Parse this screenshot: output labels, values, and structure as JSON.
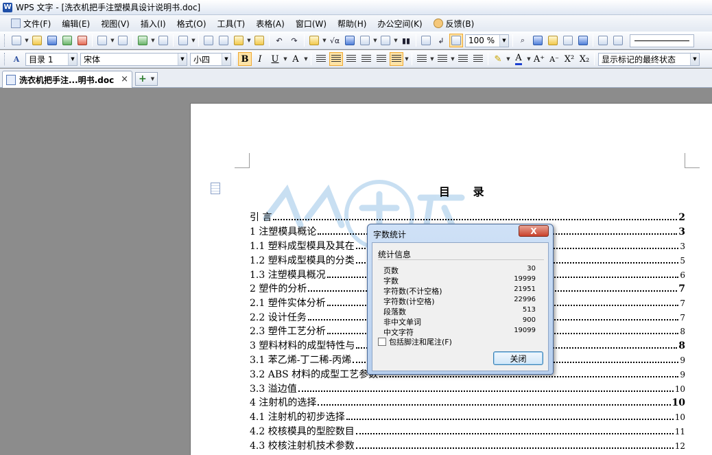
{
  "window": {
    "title": "WPS 文字 - [洗衣机把手注塑模具设计说明书.doc]"
  },
  "menu": [
    {
      "label": "文件(F)"
    },
    {
      "label": "编辑(E)"
    },
    {
      "label": "视图(V)"
    },
    {
      "label": "插入(I)"
    },
    {
      "label": "格式(O)"
    },
    {
      "label": "工具(T)"
    },
    {
      "label": "表格(A)"
    },
    {
      "label": "窗口(W)"
    },
    {
      "label": "帮助(H)"
    },
    {
      "label": "办公空间(K)"
    },
    {
      "label": "反馈(B)"
    }
  ],
  "toolbar1": {
    "zoom": "100 %"
  },
  "toolbar2": {
    "style": "目录 1",
    "font": "宋体",
    "size": "小四",
    "bold": "B",
    "italic": "I",
    "underline": "U",
    "sup": "X²",
    "sub": "X₂",
    "track": "显示标记的最终状态"
  },
  "tab": {
    "label": "洗衣机把手注...明书.doc",
    "close": "×",
    "new": "+"
  },
  "document": {
    "title": "目 录",
    "toc": [
      {
        "text": "引  言",
        "page": "2",
        "major": true
      },
      {
        "text": "1   注塑模具概论",
        "page": "3",
        "major": true
      },
      {
        "text": "1.1 塑料成型模具及其在",
        "page": "3",
        "major": false
      },
      {
        "text": "1.2 塑料成型模具的分类",
        "page": "5",
        "major": false
      },
      {
        "text": "1.3 注塑模具概况",
        "page": "6",
        "major": false
      },
      {
        "text": "2 塑件的分析",
        "page": "7",
        "major": true
      },
      {
        "text": "2.1 塑件实体分析",
        "page": "7",
        "major": false
      },
      {
        "text": "2.2 设计任务",
        "page": "7",
        "major": false
      },
      {
        "text": "2.3 塑件工艺分析",
        "page": "8",
        "major": false
      },
      {
        "text": "3 塑料材料的成型特性与",
        "page": "8",
        "major": true
      },
      {
        "text": "3.1 苯乙烯-丁二稀-丙烯",
        "page": "9",
        "major": false
      },
      {
        "text": "3.2 ABS 材料的成型工艺参数",
        "page": "9",
        "major": false
      },
      {
        "text": "3.3   溢边值",
        "page": "10",
        "major": false
      },
      {
        "text": "4 注射机的选择",
        "page": "10",
        "major": true
      },
      {
        "text": "4.1 注射机的初步选择",
        "page": "10",
        "major": false
      },
      {
        "text": "4.2 校核模具的型腔数目",
        "page": "11",
        "major": false
      },
      {
        "text": "4.3 校核注射机技术参数",
        "page": "12",
        "major": false
      }
    ]
  },
  "dialog": {
    "title": "字数统计",
    "close_glyph": "X",
    "section": "统计信息",
    "stats": [
      {
        "label": "页数",
        "value": "30"
      },
      {
        "label": "字数",
        "value": "19999"
      },
      {
        "label": "字符数(不计空格)",
        "value": "21951"
      },
      {
        "label": "字符数(计空格)",
        "value": "22996"
      },
      {
        "label": "段落数",
        "value": "513"
      },
      {
        "label": "非中文单词",
        "value": "900"
      },
      {
        "label": "中文字符",
        "value": "19099"
      }
    ],
    "checkbox": "包括脚注和尾注(F)",
    "button": "关闭"
  }
}
